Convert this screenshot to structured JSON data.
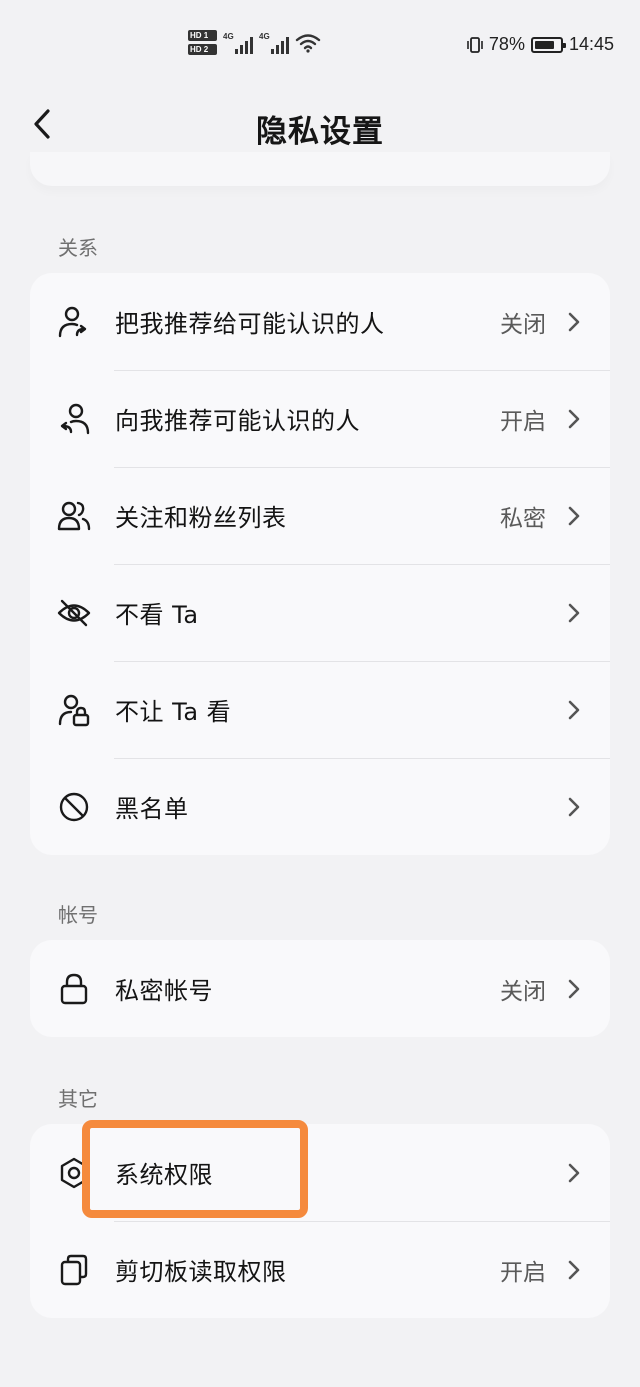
{
  "status_bar": {
    "hd1": "HD 1",
    "hd2": "HD 2",
    "net1": "4G",
    "net2": "4G",
    "battery": "78%",
    "battery_level": 0.78,
    "time": "14:45"
  },
  "header": {
    "title": "隐私设置",
    "back_icon": "chevron-left-icon"
  },
  "sections": [
    {
      "label": "关系",
      "items": [
        {
          "label": "把我推荐给可能认识的人",
          "value": "关闭",
          "icon": "user-share-icon"
        },
        {
          "label": "向我推荐可能认识的人",
          "value": "开启",
          "icon": "user-recommend-icon"
        },
        {
          "label": "关注和粉丝列表",
          "value": "私密",
          "icon": "users-icon"
        },
        {
          "label": "不看 Ta",
          "value": "",
          "icon": "eye-off-icon"
        },
        {
          "label": "不让 Ta 看",
          "value": "",
          "icon": "user-lock-icon"
        },
        {
          "label": "黑名单",
          "value": "",
          "icon": "block-icon"
        }
      ]
    },
    {
      "label": "帐号",
      "items": [
        {
          "label": "私密帐号",
          "value": "关闭",
          "icon": "lock-icon"
        }
      ]
    },
    {
      "label": "其它",
      "items": [
        {
          "label": "系统权限",
          "value": "",
          "icon": "hexagon-settings-icon"
        },
        {
          "label": "剪切板读取权限",
          "value": "开启",
          "icon": "clipboard-icon"
        }
      ]
    }
  ],
  "annotation": {
    "highlight_color": "#f58a3d",
    "target": "系统权限"
  }
}
